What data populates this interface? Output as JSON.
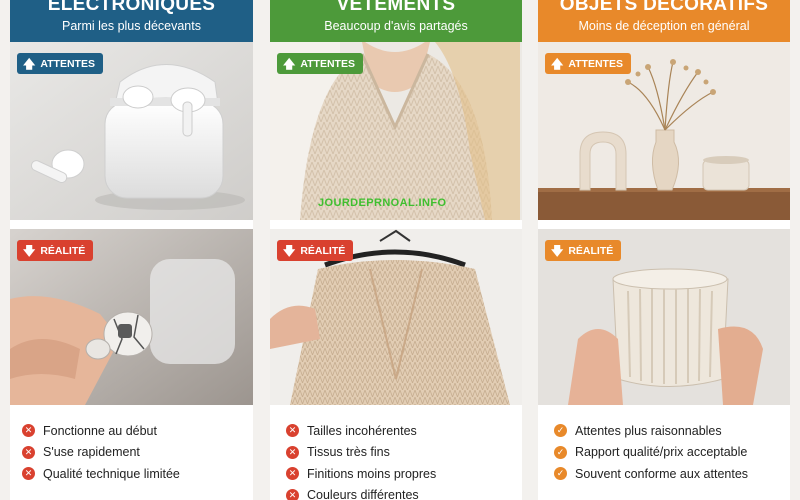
{
  "columns": [
    {
      "title": "ÉLECTRONIQUES",
      "subtitle": "Parmi les plus décevants",
      "expect_tag": "ATTENTES",
      "reality_tag": "RÉALITÉ",
      "items": [
        "Fonctionne au début",
        "S'use rapidement",
        "Qualité technique limitée"
      ]
    },
    {
      "title": "VÊTEMENTS",
      "subtitle": "Beaucoup d'avis partagés",
      "expect_tag": "ATTENTES",
      "reality_tag": "RÉALITÉ",
      "items": [
        "Tailles incohérentes",
        "Tissus très fins",
        "Finitions moins propres",
        "Couleurs différentes"
      ]
    },
    {
      "title": "OBJETS DÉCORATIFS",
      "subtitle": "Moins de déception en général",
      "expect_tag": "ATTENTES",
      "reality_tag": "RÉALITÉ",
      "items": [
        "Attentes plus raisonnables",
        "Rapport qualité/prix acceptable",
        "Souvent conforme aux attentes"
      ]
    }
  ],
  "watermark": "JOURDEPRNOAL.INFO",
  "icons": {
    "arrow_up": "arrow-up-icon",
    "arrow_down": "arrow-down-icon",
    "cross": "x-circle-icon",
    "check": "check-circle-icon"
  },
  "colors": {
    "electronics": "#1f5f86",
    "clothing": "#4d9a3a",
    "decor": "#e8892a",
    "reality": "#d9412f"
  }
}
